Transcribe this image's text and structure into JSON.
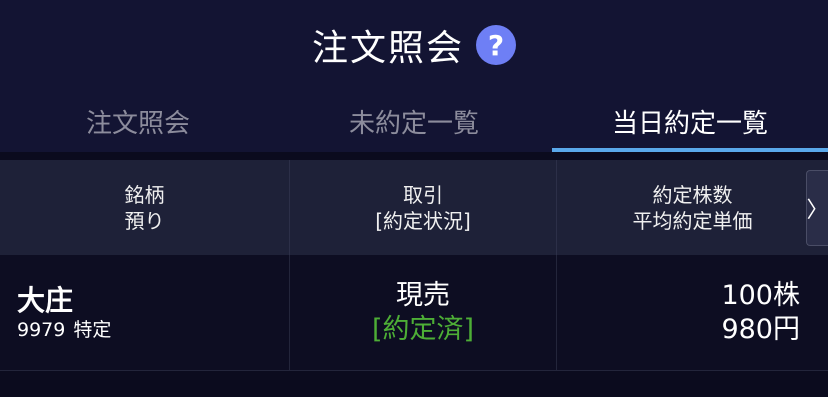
{
  "header": {
    "title": "注文照会",
    "help_symbol": "?"
  },
  "tabs": [
    {
      "label": "注文照会",
      "active": false
    },
    {
      "label": "未約定一覧",
      "active": false
    },
    {
      "label": "当日約定一覧",
      "active": true
    }
  ],
  "table": {
    "columns": [
      {
        "line1": "銘柄",
        "line2": "預り"
      },
      {
        "line1": "取引",
        "line2": "[約定状況]"
      },
      {
        "line1": "約定株数",
        "line2": "平均約定単価"
      }
    ],
    "next_symbol": "〉",
    "rows": [
      {
        "name": "大庄",
        "code": "9979",
        "account": "特定",
        "trade": "現売",
        "status": "[約定済]",
        "quantity": "100株",
        "price": "980円"
      }
    ]
  },
  "colors": {
    "header_bg": "#131433",
    "tab_active_underline": "#5aa8ea",
    "help_icon": "#6e7ff5",
    "status_green": "#4dae36",
    "column_header_bg": "#1e2138"
  }
}
